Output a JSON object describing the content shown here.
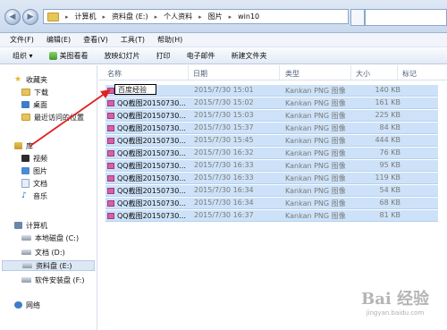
{
  "address": {
    "back_glyph": "◀",
    "forward_glyph": "▶",
    "crumbs": [
      "计算机",
      "资料盘 (E:)",
      "个人资料",
      "图片",
      "win10"
    ],
    "sep": "▸"
  },
  "menubar": [
    "文件(F)",
    "编辑(E)",
    "查看(V)",
    "工具(T)",
    "帮助(H)"
  ],
  "toolbar": {
    "organize": "组织 ▾",
    "viewer": "美图看看",
    "slideshow": "放映幻灯片",
    "print": "打印",
    "email": "电子邮件",
    "new_folder": "新建文件夹"
  },
  "nav": {
    "favorites": "收藏夹",
    "downloads": "下载",
    "desktop": "桌面",
    "recent": "最近访问的位置",
    "library": "库",
    "videos": "视频",
    "pictures": "图片",
    "documents": "文档",
    "music": "音乐",
    "computer": "计算机",
    "drive_c": "本地磁盘 (C:)",
    "drive_d": "文档 (D:)",
    "drive_e": "资料盘 (E:)",
    "drive_f": "软件安装盘 (F:)",
    "network": "网络"
  },
  "columns": {
    "name": "名称",
    "date": "日期",
    "type": "类型",
    "size": "大小",
    "tags": "标记"
  },
  "rename_value": "百度经验",
  "files": [
    {
      "name": "",
      "date": "2015/7/30 15:01",
      "type": "Kankan PNG 图像",
      "size": "140 KB"
    },
    {
      "name": "QQ截图20150730...",
      "date": "2015/7/30 15:02",
      "type": "Kankan PNG 图像",
      "size": "161 KB"
    },
    {
      "name": "QQ截图20150730...",
      "date": "2015/7/30 15:03",
      "type": "Kankan PNG 图像",
      "size": "225 KB"
    },
    {
      "name": "QQ截图20150730...",
      "date": "2015/7/30 15:37",
      "type": "Kankan PNG 图像",
      "size": "84 KB"
    },
    {
      "name": "QQ截图20150730...",
      "date": "2015/7/30 15:45",
      "type": "Kankan PNG 图像",
      "size": "444 KB"
    },
    {
      "name": "QQ截图20150730...",
      "date": "2015/7/30 16:32",
      "type": "Kankan PNG 图像",
      "size": "76 KB"
    },
    {
      "name": "QQ截图20150730...",
      "date": "2015/7/30 16:33",
      "type": "Kankan PNG 图像",
      "size": "95 KB"
    },
    {
      "name": "QQ截图20150730...",
      "date": "2015/7/30 16:33",
      "type": "Kankan PNG 图像",
      "size": "119 KB"
    },
    {
      "name": "QQ截图20150730...",
      "date": "2015/7/30 16:34",
      "type": "Kankan PNG 图像",
      "size": "54 KB"
    },
    {
      "name": "QQ截图20150730...",
      "date": "2015/7/30 16:34",
      "type": "Kankan PNG 图像",
      "size": "68 KB"
    },
    {
      "name": "QQ截图20150730...",
      "date": "2015/7/30 16:37",
      "type": "Kankan PNG 图像",
      "size": "81 KB"
    }
  ],
  "watermark": {
    "main": "Bai 经验",
    "sub": "jingyan.baidu.com"
  },
  "colors": {
    "selection": "#cde2f8",
    "arrow": "#e02020"
  }
}
